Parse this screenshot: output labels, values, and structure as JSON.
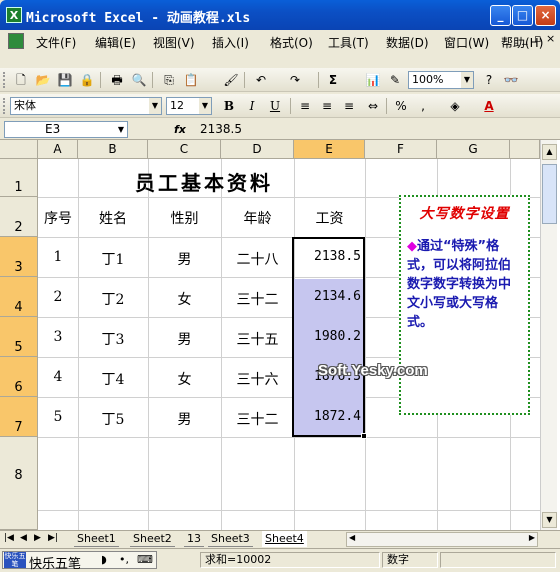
{
  "window": {
    "title": "Microsoft Excel - 动画教程.xls",
    "app_icon": "X"
  },
  "menu": [
    "文件(F)",
    "编辑(E)",
    "视图(V)",
    "插入(I)",
    "格式(O)",
    "工具(T)",
    "数据(D)",
    "窗口(W)",
    "帮助(H)"
  ],
  "toolbar": {
    "zoom": "100%",
    "font": "宋体",
    "size": "12",
    "sum": "Σ"
  },
  "formula_bar": {
    "name_box": "E3",
    "fx": "fx",
    "value": "2138.5"
  },
  "columns": [
    "A",
    "B",
    "C",
    "D",
    "E",
    "F",
    "G"
  ],
  "rows": [
    "1",
    "2",
    "3",
    "4",
    "5",
    "6",
    "7",
    "8"
  ],
  "sheet": {
    "title": "员工基本资料",
    "headers": [
      "序号",
      "姓名",
      "性别",
      "年龄",
      "工资"
    ],
    "data": [
      [
        "1",
        "丁1",
        "男",
        "二十八",
        "2138.5"
      ],
      [
        "2",
        "丁2",
        "女",
        "三十二",
        "2134.6"
      ],
      [
        "3",
        "丁3",
        "男",
        "三十五",
        "1980.2"
      ],
      [
        "4",
        "丁4",
        "女",
        "三十六",
        "1876.3"
      ],
      [
        "5",
        "丁5",
        "男",
        "三十二",
        "1872.4"
      ]
    ]
  },
  "callout": {
    "heading": "大写数字设置",
    "bullet": "◆",
    "body": "通过“特殊”格式，可以将阿拉伯数字数字转换为中文小写或大写格式。"
  },
  "watermark": "Soft.Yesky.com",
  "tabs": [
    "Sheet1",
    "Sheet2",
    "13",
    "Sheet3",
    "Sheet4"
  ],
  "active_tab": "Sheet4",
  "ime": {
    "logo": "快乐五笔",
    "name": "快乐五笔"
  },
  "status": {
    "sum": "求和=10002",
    "mode": "数字"
  }
}
